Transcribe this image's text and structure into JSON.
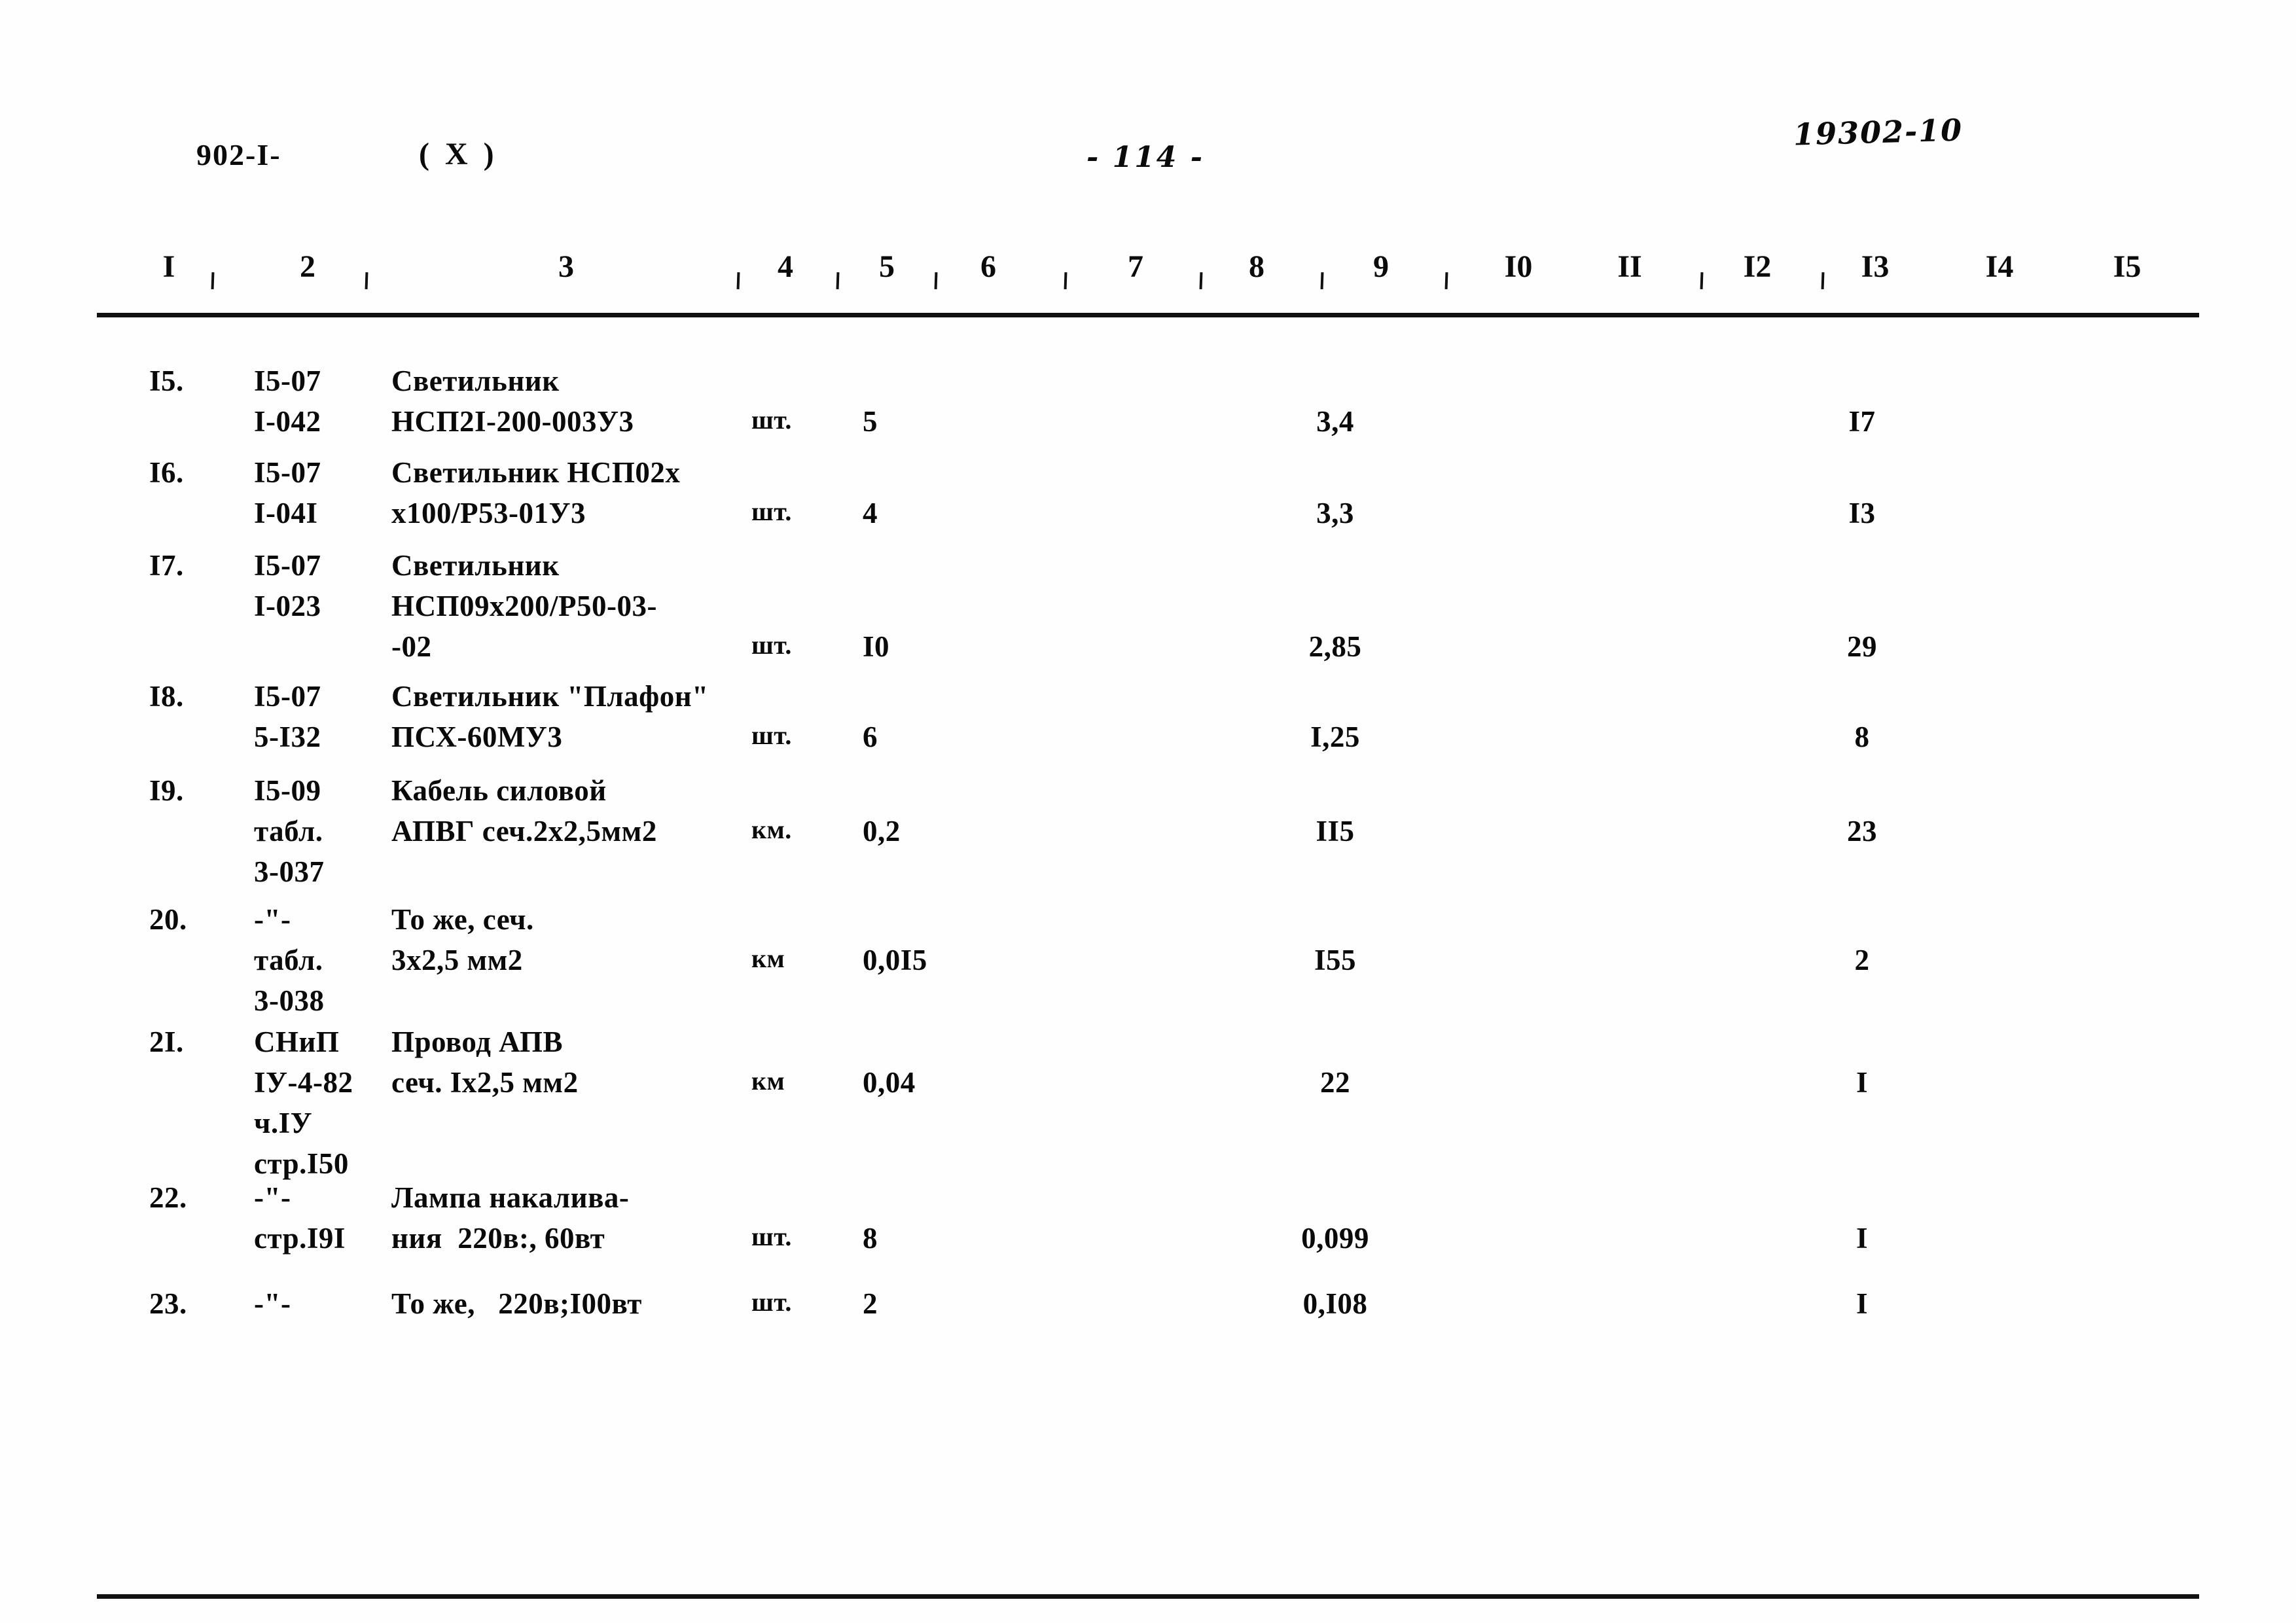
{
  "header": {
    "doc_code": "902-I-",
    "variant_mark": "( X )",
    "page_number": "- 114 -",
    "sheet_code": "19302-10"
  },
  "table": {
    "column_numbers": [
      "I",
      "2",
      "3",
      "4",
      "5",
      "6",
      "7",
      "8",
      "9",
      "I0",
      "II",
      "I2",
      "I3",
      "I4",
      "I5"
    ],
    "rows": [
      {
        "no": "I5.",
        "justification": [
          "I5-07",
          "I-042"
        ],
        "name": [
          "Светильник",
          "НСП2I-200-003У3"
        ],
        "unit": "шт.",
        "qty": "5",
        "price": "3,4",
        "sum": "I7"
      },
      {
        "no": "I6.",
        "justification": [
          "I5-07",
          "I-04I"
        ],
        "name": [
          "Светильник НСП02х",
          "х100/Р53-01У3"
        ],
        "unit": "шт.",
        "qty": "4",
        "price": "3,3",
        "sum": "I3"
      },
      {
        "no": "I7.",
        "justification": [
          "I5-07",
          "I-023"
        ],
        "name": [
          "Светильник",
          "НСП09х200/Р50-03-",
          "-02"
        ],
        "unit": "шт.",
        "qty": "I0",
        "price": "2,85",
        "sum": "29"
      },
      {
        "no": "I8.",
        "justification": [
          "I5-07",
          "5-I32"
        ],
        "name": [
          "Светильник \"Плафон\"",
          "ПСХ-60МУ3"
        ],
        "unit": "шт.",
        "qty": "6",
        "price": "I,25",
        "sum": "8"
      },
      {
        "no": "I9.",
        "justification": [
          "I5-09",
          "табл.",
          "3-037"
        ],
        "name": [
          "Кабель силовой",
          "АПВГ сеч.2х2,5мм2"
        ],
        "unit": "км.",
        "qty": "0,2",
        "price": "II5",
        "sum": "23"
      },
      {
        "no": "20.",
        "justification": [
          "-\"-",
          "табл.",
          "3-038"
        ],
        "name": [
          "То же, сеч.",
          "3х2,5 мм2"
        ],
        "unit": "км",
        "qty": "0,0I5",
        "price": "I55",
        "sum": "2"
      },
      {
        "no": "2I.",
        "justification": [
          "СНиП",
          "IУ-4-82",
          "ч.IУ",
          "стр.I50"
        ],
        "name": [
          "Провод АПВ",
          "сеч. Iх2,5 мм2"
        ],
        "unit": "км",
        "qty": "0,04",
        "price": "22",
        "sum": "I"
      },
      {
        "no": "22.",
        "justification": [
          "-\"-",
          "стр.I9I"
        ],
        "name": [
          "Лампа накалива-",
          "ния  220в:, 60вт"
        ],
        "unit": "шт.",
        "qty": "8",
        "price": "0,099",
        "sum": "I"
      },
      {
        "no": "23.",
        "justification": [
          "-\"-"
        ],
        "name": [
          "То же,   220в;I00вт"
        ],
        "unit": "шт.",
        "qty": "2",
        "price": "0,I08",
        "sum": "I"
      }
    ]
  }
}
